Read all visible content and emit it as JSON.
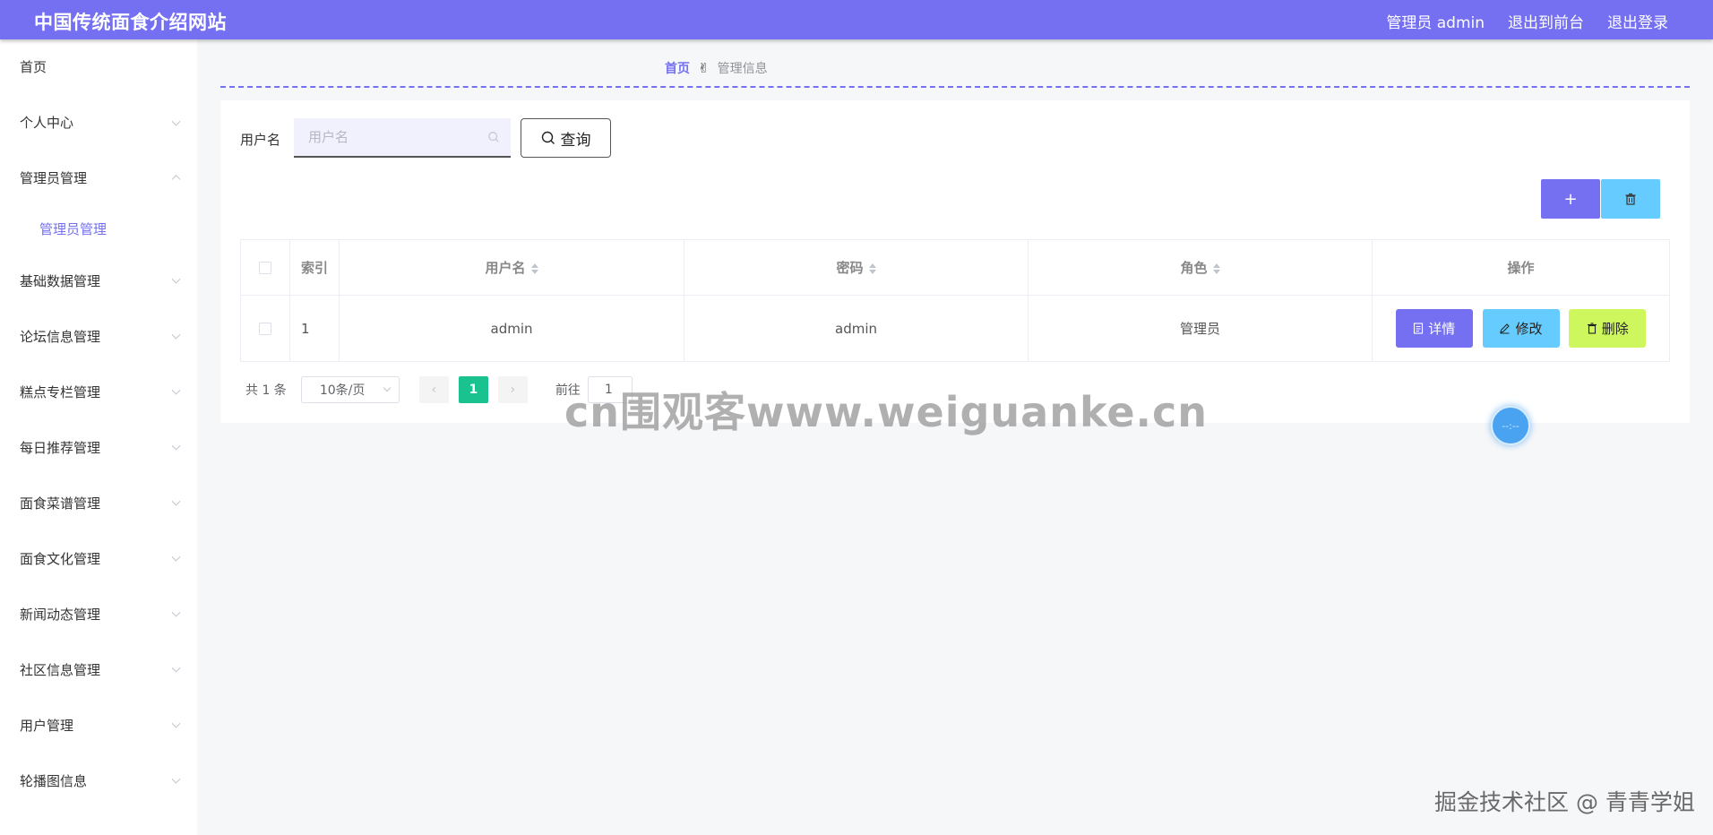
{
  "header": {
    "title": "中国传统面食介绍网站",
    "user": "管理员 admin",
    "to_front": "退出到前台",
    "logout": "退出登录"
  },
  "sidebar": {
    "items": [
      {
        "label": "首页",
        "expandable": false
      },
      {
        "label": "个人中心",
        "expandable": true
      },
      {
        "label": "管理员管理",
        "expandable": true,
        "expanded": true,
        "children": [
          "管理员管理"
        ]
      },
      {
        "label": "基础数据管理",
        "expandable": true
      },
      {
        "label": "论坛信息管理",
        "expandable": true
      },
      {
        "label": "糕点专栏管理",
        "expandable": true
      },
      {
        "label": "每日推荐管理",
        "expandable": true
      },
      {
        "label": "面食菜谱管理",
        "expandable": true
      },
      {
        "label": "面食文化管理",
        "expandable": true
      },
      {
        "label": "新闻动态管理",
        "expandable": true
      },
      {
        "label": "社区信息管理",
        "expandable": true
      },
      {
        "label": "用户管理",
        "expandable": true
      },
      {
        "label": "轮播图信息",
        "expandable": true
      }
    ]
  },
  "breadcrumb": {
    "home": "首页",
    "current": "管理信息"
  },
  "search": {
    "label": "用户名",
    "placeholder": "用户名",
    "value": "",
    "query_button": "查询"
  },
  "toolbar": {
    "add_label": "+"
  },
  "table": {
    "headers": {
      "index": "索引",
      "username": "用户名",
      "password": "密码",
      "role": "角色",
      "actions": "操作"
    },
    "rows": [
      {
        "index": "1",
        "username": "admin",
        "password": "admin",
        "role": "管理员"
      }
    ],
    "actions": {
      "detail": "详情",
      "edit": "修改",
      "delete": "删除"
    }
  },
  "pagination": {
    "total": "共 1 条",
    "page_size": "10条/页",
    "current_page": "1",
    "goto_label": "前往",
    "goto_value": "1"
  },
  "overlays": {
    "watermark": "cn围观客www.weiguanke.cn",
    "float_ball": "--:--",
    "corner_mark": "掘金技术社区 @ 青青学姐"
  },
  "colors": {
    "brand": "#7470f1",
    "info": "#66ccff",
    "danger_soft": "#cdf75d",
    "success": "#19c28e"
  }
}
